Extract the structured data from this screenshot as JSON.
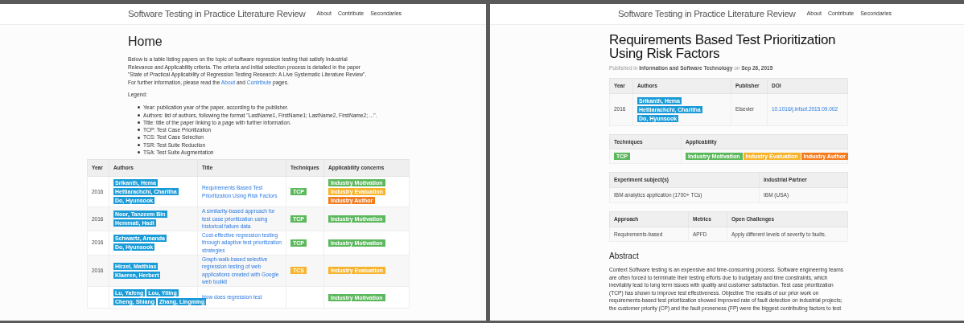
{
  "home": {
    "site_title": "Software Testing in Practice Literature Review",
    "nav": [
      "About",
      "Contribute",
      "Secondaries"
    ],
    "heading": "Home",
    "intro": [
      {
        "kind": "text",
        "text": "Below is a table listing papers on the topic of software regression testing that satisfy Industrial Relevance and Applicability criteria. The criteria and initial selection process is detailed in the paper \"State of Practical Applicability of Regression Testing Research: A Live Systematic Literature Review\". For further information, please read the "
      },
      {
        "kind": "link",
        "text": "About"
      },
      {
        "kind": "text",
        "text": " and "
      },
      {
        "kind": "link",
        "text": "Contribute"
      },
      {
        "kind": "text",
        "text": " pages."
      }
    ],
    "legend_label": "Legend:",
    "legend": [
      "Year: publication year of the paper, according to the publisher.",
      "Authors: list of authors, following the format \"LastName1, FirstName1; LastName2, FirstName2; ...\".",
      "Title: title of the paper linking to a page with further information.",
      "TCP: Test Case Prioritization",
      "TCS: Test Case Selection",
      "TSR: Test Suite Reduction",
      "TSA: Test Suite Augmentation"
    ],
    "table": {
      "columns": [
        "Year",
        "Authors",
        "Title",
        "Techniques",
        "Applicability concerns"
      ],
      "rows": [
        {
          "year": "2016",
          "author_lines": [
            [
              "Srikanth, Hema"
            ],
            [
              "Hettiarachchi, Charitha"
            ],
            [
              "Do, Hyunsook"
            ]
          ],
          "title": "Requirements Based Test Prioritization Using Risk Factors",
          "techniques": [
            {
              "label": "TCP",
              "color": "#5cb85c"
            }
          ],
          "concerns": [
            {
              "label": "Industry Motivation",
              "color": "#5cb85c"
            },
            {
              "label": "Industry Evaluation",
              "color": "#f7b32b"
            },
            {
              "label": "Industry Author",
              "color": "#f47c20"
            }
          ]
        },
        {
          "year": "2016",
          "author_lines": [
            [
              "Noor, Tanzeem Bin"
            ],
            [
              "Hemmati, Hadi"
            ]
          ],
          "title": "A similarity-based approach for test case prioritization using historical failure data",
          "techniques": [
            {
              "label": "TCP",
              "color": "#5cb85c"
            }
          ],
          "concerns": [
            {
              "label": "Industry Motivation",
              "color": "#5cb85c"
            }
          ]
        },
        {
          "year": "2016",
          "author_lines": [
            [
              "Schwartz, Amanda"
            ],
            [
              "Do, Hyunsook"
            ]
          ],
          "title": "Cost-effective regression testing through adaptive test prioritization strategies",
          "techniques": [
            {
              "label": "TCP",
              "color": "#5cb85c"
            }
          ],
          "concerns": [
            {
              "label": "Industry Motivation",
              "color": "#5cb85c"
            }
          ]
        },
        {
          "year": "2016",
          "author_lines": [
            [
              "Hirzel, Matthias"
            ],
            [
              "Klaeren, Herbert"
            ]
          ],
          "title": "Graph-walk-based selective regression testing of web applications created with Google web toolkit",
          "techniques": [
            {
              "label": "TCS",
              "color": "#f7b32b"
            }
          ],
          "concerns": [
            {
              "label": "Industry Evaluation",
              "color": "#f7b32b"
            }
          ]
        },
        {
          "author_lines": [
            [
              "Lu, Yafeng",
              "Lou, Yiling"
            ],
            [
              "Cheng, Shiang",
              "Zhang, Lingming"
            ]
          ],
          "title": "How does regression test",
          "techniques": [],
          "concerns": [
            {
              "label": "Industry Motivation",
              "color": "#5cb85c"
            }
          ]
        }
      ]
    }
  },
  "paper": {
    "site_title": "Software Testing in Practice Literature Review",
    "nav": [
      "About",
      "Contribute",
      "Secondaries"
    ],
    "title": "Requirements Based Test Prioritization Using Risk Factors",
    "published": {
      "prefix": "Published in",
      "venue": "Information and Software Technology",
      "on": "on",
      "date": "Sep 26, 2015"
    },
    "info": {
      "columns": [
        "Year",
        "Authors",
        "Publisher",
        "DOI"
      ],
      "year": "2016",
      "authors": [
        "Srikanth, Hema",
        "Hettiarachchi, Charitha",
        "Do, Hyunsook"
      ],
      "publisher": "Elsevier",
      "doi": "10.1016/j.infsof.2015.09.002"
    },
    "classification": {
      "columns": [
        "Techniques",
        "Applicability"
      ],
      "techniques": [
        {
          "label": "TCP",
          "color": "#5cb85c"
        }
      ],
      "applicability": [
        {
          "label": "Industry Motivation",
          "color": "#5cb85c"
        },
        {
          "label": "Industry Evaluation",
          "color": "#f7b32b"
        },
        {
          "label": "Industry Author",
          "color": "#f47c20"
        }
      ]
    },
    "experiment": {
      "columns": [
        "Experiment subject(s)",
        "Industrial Partner"
      ],
      "cells": [
        "IBM analytics application (1700+ TCs)",
        "IBM (USA)"
      ]
    },
    "approach": {
      "columns": [
        "Approach",
        "Metrics",
        "Open Challenges"
      ],
      "cells": [
        "Requirements-based",
        "APFD",
        "Apply different levels of severity to faults."
      ]
    },
    "abstract_heading": "Abstract",
    "abstract": "Context Software testing is an expensive and time-consuming process. Software engineering teams are often forced to terminate their testing efforts due to budgetary and time constraints, which inevitably lead to long term issues with quality and customer satisfaction. Test case prioritization (TCP) has shown to improve test effectiveness. Objective The results of our prior work on requirements-based test prioritization showed improved rate of fault detection on industrial projects; the customer priority (CP) and the fault proneness (FP) were the biggest contributing factors to test"
  }
}
